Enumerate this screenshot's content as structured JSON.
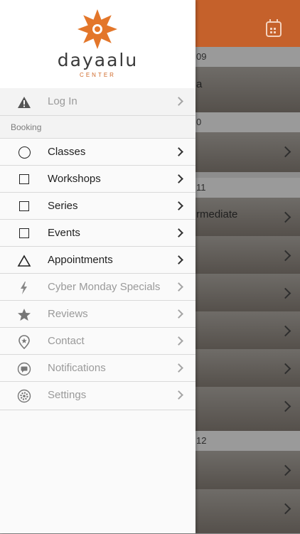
{
  "background": {
    "dates": [
      "09",
      "0",
      "11",
      "12"
    ],
    "texts": [
      "a",
      "rmediate"
    ]
  },
  "header": {
    "calendar_icon": "calendar-icon",
    "accent": "#c5612b"
  },
  "logo": {
    "name": "dayaalu",
    "subtitle": "CENTER",
    "mark_color": "#e3762a"
  },
  "menu": {
    "login": {
      "label": "Log In",
      "icon": "alert-triangle-icon"
    },
    "section_label": "Booking",
    "items": [
      {
        "label": "Classes",
        "icon": "circle-icon",
        "active": true
      },
      {
        "label": "Workshops",
        "icon": "square-icon",
        "active": true
      },
      {
        "label": "Series",
        "icon": "square-icon",
        "active": true
      },
      {
        "label": "Events",
        "icon": "square-icon",
        "active": true
      },
      {
        "label": "Appointments",
        "icon": "triangle-icon",
        "active": true
      },
      {
        "label": "Cyber Monday Specials",
        "icon": "lightning-icon",
        "active": false
      },
      {
        "label": "Reviews",
        "icon": "star-icon",
        "active": false
      },
      {
        "label": "Contact",
        "icon": "map-pin-icon",
        "active": false
      },
      {
        "label": "Notifications",
        "icon": "chat-icon",
        "active": false
      },
      {
        "label": "Settings",
        "icon": "gear-icon",
        "active": false
      }
    ]
  }
}
